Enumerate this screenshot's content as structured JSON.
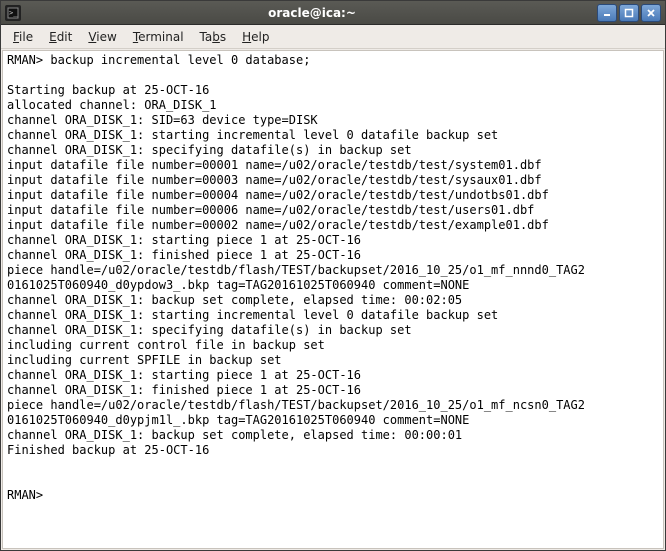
{
  "window": {
    "title": "oracle@ica:~"
  },
  "menubar": {
    "file": "File",
    "edit": "Edit",
    "view": "View",
    "terminal": "Terminal",
    "tabs": "Tabs",
    "help": "Help"
  },
  "terminal": {
    "lines": [
      "RMAN> backup incremental level 0 database;",
      "",
      "Starting backup at 25-OCT-16",
      "allocated channel: ORA_DISK_1",
      "channel ORA_DISK_1: SID=63 device type=DISK",
      "channel ORA_DISK_1: starting incremental level 0 datafile backup set",
      "channel ORA_DISK_1: specifying datafile(s) in backup set",
      "input datafile file number=00001 name=/u02/oracle/testdb/test/system01.dbf",
      "input datafile file number=00003 name=/u02/oracle/testdb/test/sysaux01.dbf",
      "input datafile file number=00004 name=/u02/oracle/testdb/test/undotbs01.dbf",
      "input datafile file number=00006 name=/u02/oracle/testdb/test/users01.dbf",
      "input datafile file number=00002 name=/u02/oracle/testdb/test/example01.dbf",
      "channel ORA_DISK_1: starting piece 1 at 25-OCT-16",
      "channel ORA_DISK_1: finished piece 1 at 25-OCT-16",
      "piece handle=/u02/oracle/testdb/flash/TEST/backupset/2016_10_25/o1_mf_nnnd0_TAG2",
      "0161025T060940_d0ypdow3_.bkp tag=TAG20161025T060940 comment=NONE",
      "channel ORA_DISK_1: backup set complete, elapsed time: 00:02:05",
      "channel ORA_DISK_1: starting incremental level 0 datafile backup set",
      "channel ORA_DISK_1: specifying datafile(s) in backup set",
      "including current control file in backup set",
      "including current SPFILE in backup set",
      "channel ORA_DISK_1: starting piece 1 at 25-OCT-16",
      "channel ORA_DISK_1: finished piece 1 at 25-OCT-16",
      "piece handle=/u02/oracle/testdb/flash/TEST/backupset/2016_10_25/o1_mf_ncsn0_TAG2",
      "0161025T060940_d0ypjm1l_.bkp tag=TAG20161025T060940 comment=NONE",
      "channel ORA_DISK_1: backup set complete, elapsed time: 00:00:01",
      "Finished backup at 25-OCT-16",
      "",
      "",
      "RMAN>"
    ]
  }
}
